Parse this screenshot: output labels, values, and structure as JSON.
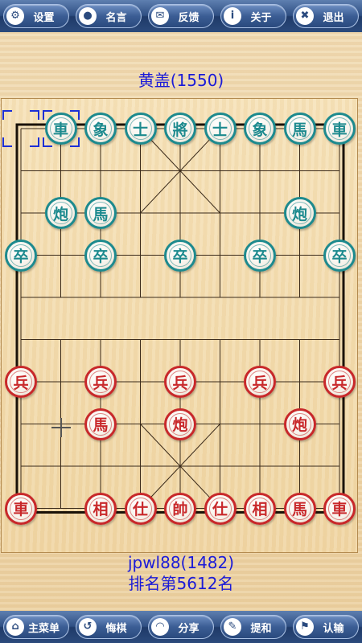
{
  "top_toolbar": [
    {
      "id": "settings",
      "label": "设置",
      "icon": "gear-icon",
      "glyph": "⚙"
    },
    {
      "id": "quotes",
      "label": "名言",
      "icon": "speech-bubble-icon",
      "glyph": "●"
    },
    {
      "id": "feedback",
      "label": "反馈",
      "icon": "envelope-icon",
      "glyph": "✉"
    },
    {
      "id": "about",
      "label": "关于",
      "icon": "info-icon",
      "glyph": "i"
    },
    {
      "id": "exit",
      "label": "退出",
      "icon": "close-icon",
      "glyph": "✖"
    }
  ],
  "bottom_toolbar": [
    {
      "id": "main-menu",
      "label": "主菜单",
      "icon": "home-icon",
      "glyph": "⌂"
    },
    {
      "id": "undo",
      "label": "悔棋",
      "icon": "undo-icon",
      "glyph": "↺"
    },
    {
      "id": "share",
      "label": "分享",
      "icon": "rss-icon",
      "glyph": "◠"
    },
    {
      "id": "draw",
      "label": "提和",
      "icon": "pencil-icon",
      "glyph": "✎"
    },
    {
      "id": "resign",
      "label": "认输",
      "icon": "flag-icon",
      "glyph": "⚑"
    }
  ],
  "opponent": {
    "name": "黄盖(1550)"
  },
  "player": {
    "name": "jpwl88(1482)",
    "rank": "排名第5612名"
  },
  "colors": {
    "red": "#c8282a",
    "black": "#1d8a8e",
    "name_text": "#1b1bd8"
  },
  "board": {
    "files": 9,
    "ranks": 10,
    "selection": {
      "file": 0,
      "rank": 0
    },
    "pieces": [
      {
        "side": "black",
        "char": "車",
        "file": 1,
        "rank": 0
      },
      {
        "side": "black",
        "char": "象",
        "file": 2,
        "rank": 0
      },
      {
        "side": "black",
        "char": "士",
        "file": 3,
        "rank": 0
      },
      {
        "side": "black",
        "char": "將",
        "file": 4,
        "rank": 0
      },
      {
        "side": "black",
        "char": "士",
        "file": 5,
        "rank": 0
      },
      {
        "side": "black",
        "char": "象",
        "file": 6,
        "rank": 0
      },
      {
        "side": "black",
        "char": "馬",
        "file": 7,
        "rank": 0
      },
      {
        "side": "black",
        "char": "車",
        "file": 8,
        "rank": 0
      },
      {
        "side": "black",
        "char": "炮",
        "file": 1,
        "rank": 2
      },
      {
        "side": "black",
        "char": "馬",
        "file": 2,
        "rank": 2
      },
      {
        "side": "black",
        "char": "炮",
        "file": 7,
        "rank": 2
      },
      {
        "side": "black",
        "char": "卒",
        "file": 0,
        "rank": 3
      },
      {
        "side": "black",
        "char": "卒",
        "file": 2,
        "rank": 3
      },
      {
        "side": "black",
        "char": "卒",
        "file": 4,
        "rank": 3
      },
      {
        "side": "black",
        "char": "卒",
        "file": 6,
        "rank": 3
      },
      {
        "side": "black",
        "char": "卒",
        "file": 8,
        "rank": 3
      },
      {
        "side": "red",
        "char": "兵",
        "file": 0,
        "rank": 6
      },
      {
        "side": "red",
        "char": "兵",
        "file": 2,
        "rank": 6
      },
      {
        "side": "red",
        "char": "兵",
        "file": 4,
        "rank": 6
      },
      {
        "side": "red",
        "char": "兵",
        "file": 6,
        "rank": 6
      },
      {
        "side": "red",
        "char": "兵",
        "file": 8,
        "rank": 6
      },
      {
        "side": "red",
        "char": "馬",
        "file": 2,
        "rank": 7
      },
      {
        "side": "red",
        "char": "炮",
        "file": 4,
        "rank": 7
      },
      {
        "side": "red",
        "char": "炮",
        "file": 7,
        "rank": 7
      },
      {
        "side": "red",
        "char": "車",
        "file": 0,
        "rank": 9
      },
      {
        "side": "red",
        "char": "相",
        "file": 2,
        "rank": 9
      },
      {
        "side": "red",
        "char": "仕",
        "file": 3,
        "rank": 9
      },
      {
        "side": "red",
        "char": "帥",
        "file": 4,
        "rank": 9
      },
      {
        "side": "red",
        "char": "仕",
        "file": 5,
        "rank": 9
      },
      {
        "side": "red",
        "char": "相",
        "file": 6,
        "rank": 9
      },
      {
        "side": "red",
        "char": "馬",
        "file": 7,
        "rank": 9
      },
      {
        "side": "red",
        "char": "車",
        "file": 8,
        "rank": 9
      }
    ]
  }
}
